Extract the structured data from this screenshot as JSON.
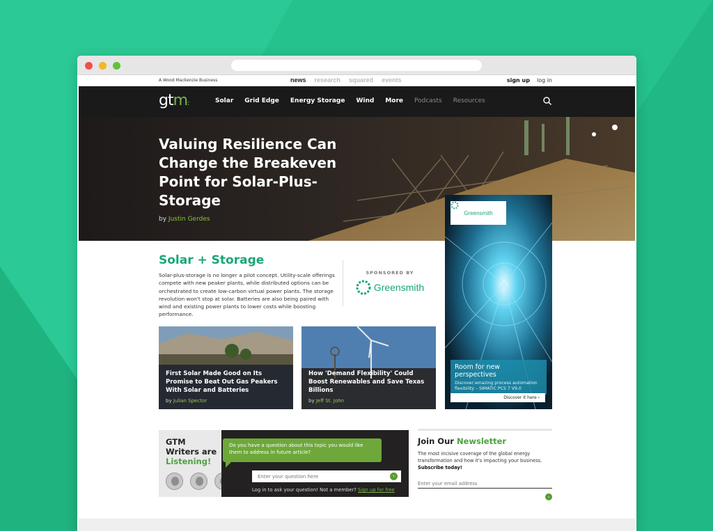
{
  "topbar": {
    "brand": "A Wood Mackenzie Business",
    "tabs": [
      "news",
      "research",
      "squared",
      "events"
    ],
    "active_tab": "news",
    "sign_up": "sign up",
    "log_in": "log in"
  },
  "nav": {
    "logo_text": "gt",
    "logo_accent": "m",
    "logo_dots": ":",
    "items": [
      "Solar",
      "Grid Edge",
      "Energy Storage",
      "Wind",
      "More"
    ],
    "dim_items": [
      "Podcasts",
      "Resources"
    ]
  },
  "hero": {
    "title": "Valuing Resilience Can Change the Breakeven Point for Solar-Plus-Storage",
    "by": "by",
    "author": "Justin Gerdes"
  },
  "section": {
    "title": "Solar + Storage",
    "body": "Solar-plus-storage is no longer a pilot concept. Utility-scale offerings compete with new peaker plants, while distributed options can be orchestrated to create low-carbon virtual power plants. The storage revolution won't stop at solar. Batteries are also being paired with wind and existing power plants to lower costs while boosting performance.",
    "sponsored_label": "SPONSORED BY",
    "sponsor_name": "Greensmith"
  },
  "cards": [
    {
      "title": "First Solar Made Good on Its Promise to Beat Out Gas Peakers With Solar and Batteries",
      "by": "by",
      "author": "Julian Spector"
    },
    {
      "title": "How 'Demand Flexibility' Could Boost Renewables and Save Texas Billions",
      "by": "by",
      "author": "Jeff St. John"
    }
  ],
  "ad": {
    "logo": "Greensmith",
    "headline": "Room for new perspectives",
    "text": "Discover amazing process automation flexibility – SIMATIC PCS 7 V9.0",
    "cta": "Discover it here ›"
  },
  "writers": {
    "title_line1": "GTM",
    "title_line2": "Writers are",
    "title_line3": "Listening!",
    "bubble": "Do you have a question about this topic you would like them to address in future article?",
    "input_placeholder": "Enter your question here",
    "login_text": "Log in to ask your question! Not a member?",
    "signup_link": "Sign up for free"
  },
  "newsletter": {
    "title_a": "Join Our",
    "title_b": "Newsletter",
    "body": "The most incisive coverage of the global energy transformation and how it's impacting your business.",
    "body_bold": "Subscribe today!",
    "email_placeholder": "Enter your email address"
  },
  "colors": {
    "background": "#25c28d",
    "brand_green": "#1aa67a",
    "accent_green": "#7ab648",
    "nav_dark": "#1a1a1b"
  }
}
